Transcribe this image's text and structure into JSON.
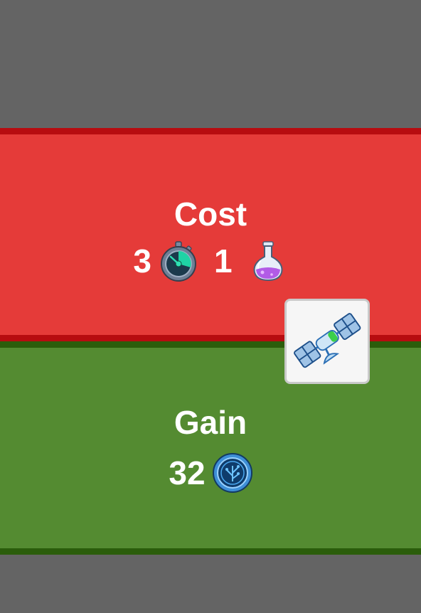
{
  "cost": {
    "title": "Cost",
    "items": [
      {
        "amount": "3",
        "icon": "stopwatch-icon"
      },
      {
        "amount": "1",
        "icon": "potion-flask-icon"
      }
    ]
  },
  "gain": {
    "title": "Gain",
    "items": [
      {
        "amount": "32",
        "icon": "tech-coin-icon"
      }
    ]
  },
  "item_icon": "satellite-icon",
  "colors": {
    "background": "#646464",
    "cost_band": "#e53b39",
    "cost_border": "#b70c10",
    "gain_band": "#548b31",
    "gain_border": "#2b5d0b"
  }
}
